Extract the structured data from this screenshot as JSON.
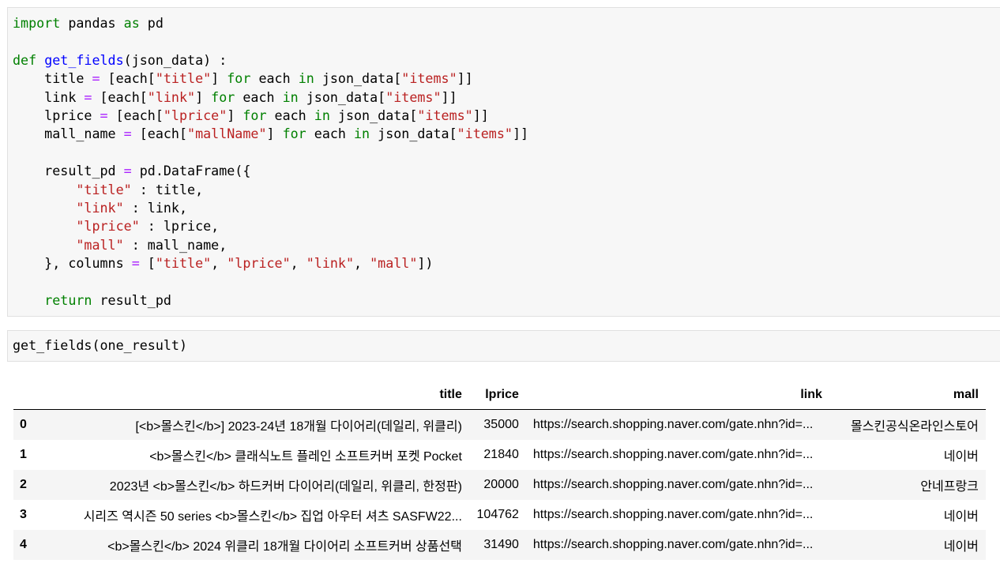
{
  "cells": [
    {
      "lines": [
        [
          {
            "t": "import",
            "c": "kw"
          },
          {
            "t": " pandas "
          },
          {
            "t": "as",
            "c": "kw"
          },
          {
            "t": " pd"
          }
        ],
        [],
        [
          {
            "t": "def",
            "c": "kw"
          },
          {
            "t": " "
          },
          {
            "t": "get_fields",
            "c": "fn"
          },
          {
            "t": "(json_data) :"
          }
        ],
        [
          {
            "t": "    title "
          },
          {
            "t": "=",
            "c": "op"
          },
          {
            "t": " [each["
          },
          {
            "t": "\"title\"",
            "c": "str"
          },
          {
            "t": "] "
          },
          {
            "t": "for",
            "c": "kw"
          },
          {
            "t": " each "
          },
          {
            "t": "in",
            "c": "kw"
          },
          {
            "t": " json_data["
          },
          {
            "t": "\"items\"",
            "c": "str"
          },
          {
            "t": "]]"
          }
        ],
        [
          {
            "t": "    link "
          },
          {
            "t": "=",
            "c": "op"
          },
          {
            "t": " [each["
          },
          {
            "t": "\"link\"",
            "c": "str"
          },
          {
            "t": "] "
          },
          {
            "t": "for",
            "c": "kw"
          },
          {
            "t": " each "
          },
          {
            "t": "in",
            "c": "kw"
          },
          {
            "t": " json_data["
          },
          {
            "t": "\"items\"",
            "c": "str"
          },
          {
            "t": "]]"
          }
        ],
        [
          {
            "t": "    lprice "
          },
          {
            "t": "=",
            "c": "op"
          },
          {
            "t": " [each["
          },
          {
            "t": "\"lprice\"",
            "c": "str"
          },
          {
            "t": "] "
          },
          {
            "t": "for",
            "c": "kw"
          },
          {
            "t": " each "
          },
          {
            "t": "in",
            "c": "kw"
          },
          {
            "t": " json_data["
          },
          {
            "t": "\"items\"",
            "c": "str"
          },
          {
            "t": "]]"
          }
        ],
        [
          {
            "t": "    mall_name "
          },
          {
            "t": "=",
            "c": "op"
          },
          {
            "t": " [each["
          },
          {
            "t": "\"mallName\"",
            "c": "str"
          },
          {
            "t": "] "
          },
          {
            "t": "for",
            "c": "kw"
          },
          {
            "t": " each "
          },
          {
            "t": "in",
            "c": "kw"
          },
          {
            "t": " json_data["
          },
          {
            "t": "\"items\"",
            "c": "str"
          },
          {
            "t": "]]"
          }
        ],
        [],
        [
          {
            "t": "    result_pd "
          },
          {
            "t": "=",
            "c": "op"
          },
          {
            "t": " pd.DataFrame({"
          }
        ],
        [
          {
            "t": "        "
          },
          {
            "t": "\"title\"",
            "c": "str"
          },
          {
            "t": " : title,"
          }
        ],
        [
          {
            "t": "        "
          },
          {
            "t": "\"link\"",
            "c": "str"
          },
          {
            "t": " : link,"
          }
        ],
        [
          {
            "t": "        "
          },
          {
            "t": "\"lprice\"",
            "c": "str"
          },
          {
            "t": " : lprice,"
          }
        ],
        [
          {
            "t": "        "
          },
          {
            "t": "\"mall\"",
            "c": "str"
          },
          {
            "t": " : mall_name,"
          }
        ],
        [
          {
            "t": "    }, columns "
          },
          {
            "t": "=",
            "c": "op"
          },
          {
            "t": " ["
          },
          {
            "t": "\"title\"",
            "c": "str"
          },
          {
            "t": ", "
          },
          {
            "t": "\"lprice\"",
            "c": "str"
          },
          {
            "t": ", "
          },
          {
            "t": "\"link\"",
            "c": "str"
          },
          {
            "t": ", "
          },
          {
            "t": "\"mall\"",
            "c": "str"
          },
          {
            "t": "])"
          }
        ],
        [],
        [
          {
            "t": "    "
          },
          {
            "t": "return",
            "c": "kw"
          },
          {
            "t": " result_pd"
          }
        ]
      ]
    },
    {
      "lines": [
        [
          {
            "t": "get_fields(one_result)"
          }
        ]
      ]
    }
  ],
  "output_table": {
    "columns": [
      "",
      "title",
      "lprice",
      "link",
      "mall"
    ],
    "rows": [
      {
        "index": "0",
        "title": "[<b>몰스킨</b>] 2023-24년 18개월 다이어리(데일리, 위클리)",
        "lprice": "35000",
        "link": "https://search.shopping.naver.com/gate.nhn?id=...",
        "mall": "몰스킨공식온라인스토어"
      },
      {
        "index": "1",
        "title": "<b>몰스킨</b> 클래식노트 플레인 소프트커버 포켓 Pocket",
        "lprice": "21840",
        "link": "https://search.shopping.naver.com/gate.nhn?id=...",
        "mall": "네이버"
      },
      {
        "index": "2",
        "title": "2023년 <b>몰스킨</b> 하드커버 다이어리(데일리, 위클리, 한정판)",
        "lprice": "20000",
        "link": "https://search.shopping.naver.com/gate.nhn?id=...",
        "mall": "안네프랑크"
      },
      {
        "index": "3",
        "title": "시리즈 역시즌 50 series <b>몰스킨</b> 집업 아우터 셔츠 SASFW22...",
        "lprice": "104762",
        "link": "https://search.shopping.naver.com/gate.nhn?id=...",
        "mall": "네이버"
      },
      {
        "index": "4",
        "title": "<b>몰스킨</b> 2024 위클리 18개월 다이어리 소프트커버 상품선택",
        "lprice": "31490",
        "link": "https://search.shopping.naver.com/gate.nhn?id=...",
        "mall": "네이버"
      }
    ]
  },
  "colors": {
    "keyword": "#008000",
    "function": "#0000ff",
    "string": "#ba2121",
    "operator": "#aa22ff",
    "cell_bg": "#f7f7f7",
    "row_alt": "#f5f5f5"
  }
}
